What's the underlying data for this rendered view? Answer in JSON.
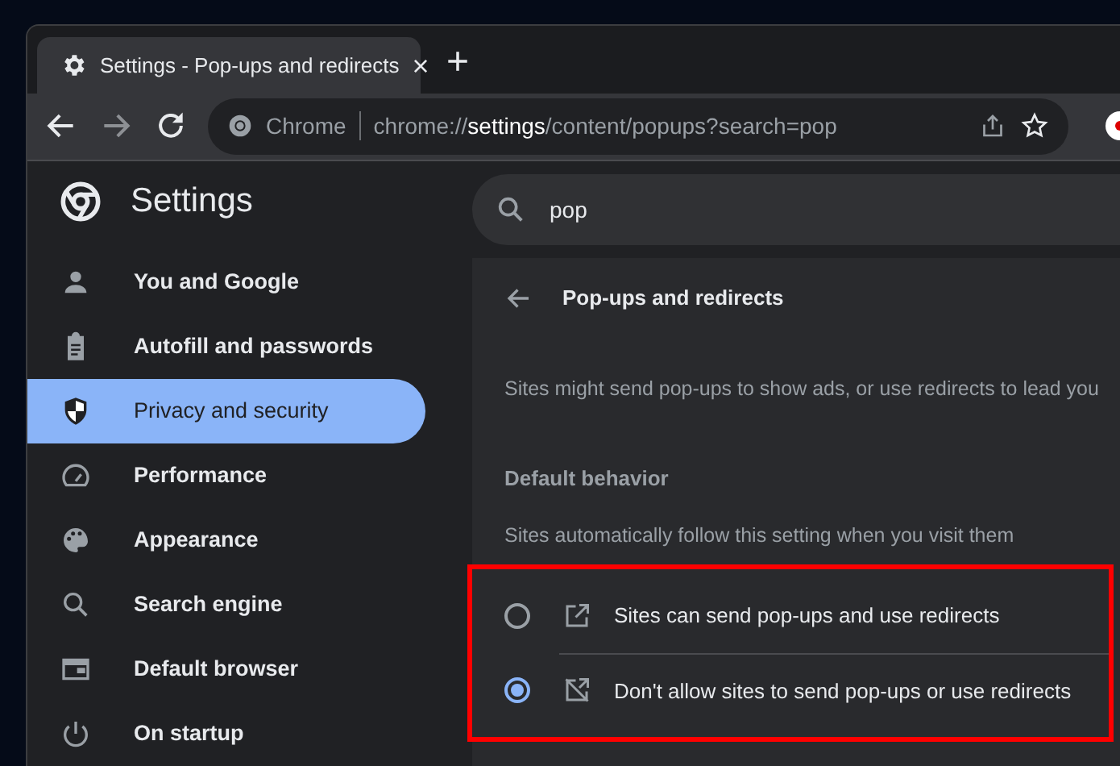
{
  "tab": {
    "title": "Settings - Pop-ups and redirects",
    "close": "×",
    "new_tab": "+"
  },
  "toolbar": {
    "site_label": "Chrome",
    "url": "chrome://**settings**/content/popups?search=pop"
  },
  "header": {
    "title": "Settings",
    "search_value": "pop"
  },
  "sidebar": {
    "items": [
      {
        "label": "You and Google",
        "selected": false
      },
      {
        "label": "Autofill and passwords",
        "selected": false
      },
      {
        "label": "Privacy and security",
        "selected": true
      },
      {
        "label": "Performance",
        "selected": false
      },
      {
        "label": "Appearance",
        "selected": false
      },
      {
        "label": "Search engine",
        "selected": false
      },
      {
        "label": "Default browser",
        "selected": false
      },
      {
        "label": "On startup",
        "selected": false
      }
    ]
  },
  "page": {
    "title": "Pop-ups and redirects",
    "description": "Sites might send pop-ups to show ads, or use redirects to lead you",
    "section_title": "Default behavior",
    "section_subtitle": "Sites automatically follow this setting when you visit them",
    "options_highlighted": true,
    "options": [
      {
        "label": "Sites can send pop-ups and use redirects",
        "selected": false
      },
      {
        "label": "Don't allow sites to send pop-ups or use redirects",
        "selected": true
      }
    ]
  }
}
